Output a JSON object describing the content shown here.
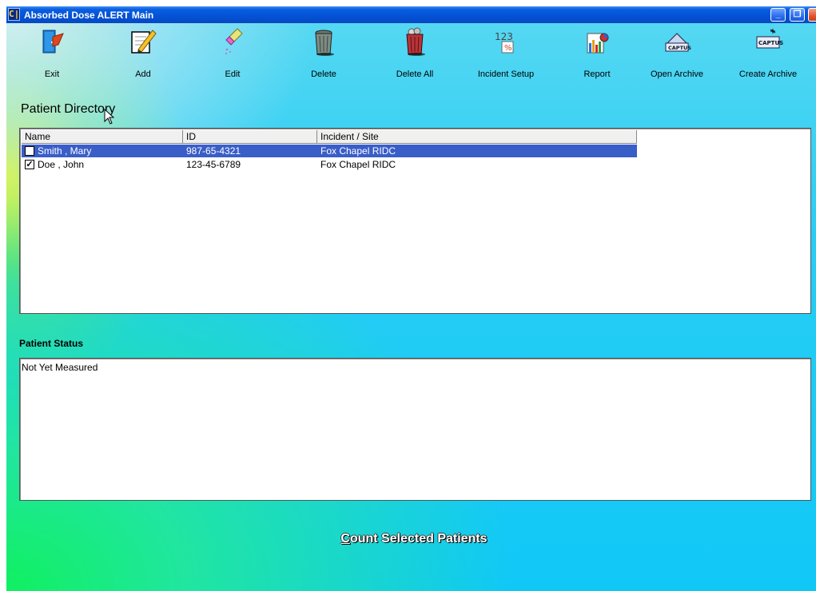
{
  "window": {
    "logo_text": "C|",
    "title": "Absorbed Dose ALERT  Main",
    "minimize_glyph": "_",
    "restore_glyph": "❐"
  },
  "toolbar": {
    "exit": "Exit",
    "add": "Add",
    "edit": "Edit",
    "delete": "Delete",
    "delete_all": "Delete All",
    "incident_setup": "Incident Setup",
    "report": "Report",
    "open_archive": "Open Archive",
    "create_archive": "Create Archive",
    "incident_icon_text": "123",
    "incident_icon_pct": "%",
    "archive_icon_text": "CAPTUS"
  },
  "directory": {
    "title": "Patient Directory",
    "columns": [
      "Name",
      "ID",
      "Incident / Site"
    ],
    "rows": [
      {
        "checked": false,
        "check_glyph": "",
        "name": "Smith , Mary",
        "id": "987-65-4321",
        "site": "Fox Chapel RIDC",
        "selected": true
      },
      {
        "checked": true,
        "check_glyph": "✓",
        "name": "Doe , John",
        "id": "123-45-6789",
        "site": "Fox Chapel RIDC",
        "selected": false
      }
    ]
  },
  "status": {
    "title": "Patient Status",
    "text": "Not Yet Measured"
  },
  "count_button": {
    "first_letter": "C",
    "rest": "ount Selected Patients"
  },
  "colors": {
    "selection": "#3a5ec8",
    "titlebar": "#0352d6"
  }
}
